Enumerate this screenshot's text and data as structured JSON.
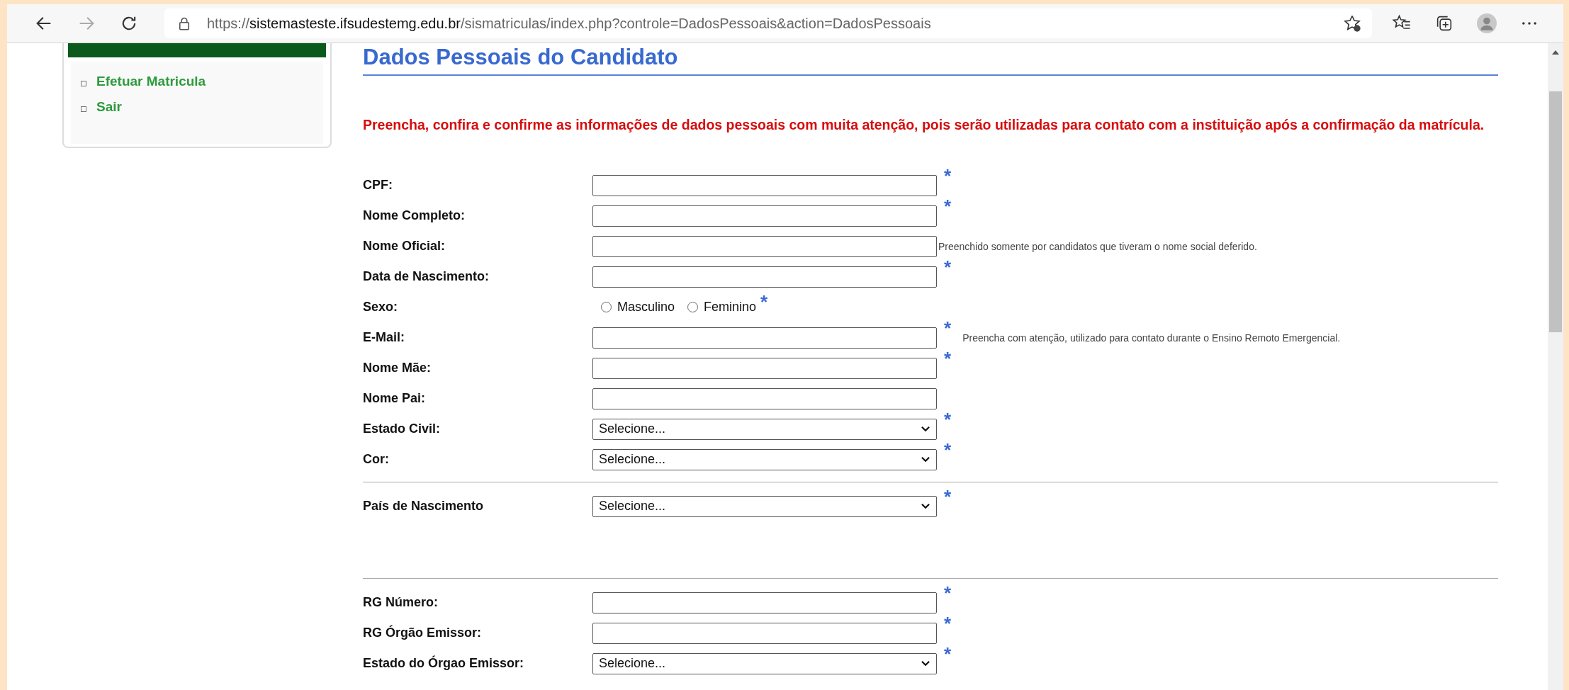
{
  "browser": {
    "url": {
      "scheme": "https://",
      "host": "sistemasteste.ifsudestemg.edu.br",
      "path": "/sismatriculas/index.php?controle=DadosPessoais&action=DadosPessoais"
    }
  },
  "sidebar": {
    "items": [
      {
        "label": "Efetuar Matricula"
      },
      {
        "label": "Sair"
      }
    ]
  },
  "page": {
    "title": "Dados Pessoais do Candidato",
    "notice": "Preencha, confira e confirme as informações de dados pessoais com muita atenção, pois serão utilizadas para contato com a instituição após a confirmação da matrícula."
  },
  "sections": [
    {
      "rows": [
        {
          "kind": "text",
          "label": "CPF:",
          "mark": "*"
        },
        {
          "kind": "text",
          "label": "Nome Completo:",
          "mark": "*"
        },
        {
          "kind": "text",
          "label": "Nome Oficial:",
          "hint": "Preenchido somente por candidatos que tiveram o nome social deferido."
        },
        {
          "kind": "text",
          "label": "Data de Nascimento:",
          "mark": "*"
        },
        {
          "kind": "radio",
          "label": "Sexo:",
          "mark": "*",
          "options": [
            {
              "label": "Masculino",
              "selected": false
            },
            {
              "label": "Feminino",
              "selected": false
            }
          ]
        },
        {
          "kind": "text",
          "label": "E-Mail:",
          "mark": "*",
          "hint": "Preencha com atenção, utilizado para contato durante o Ensino Remoto Emergencial."
        },
        {
          "kind": "text",
          "label": "Nome Mãe:",
          "mark": "*"
        },
        {
          "kind": "text",
          "label": "Nome Pai:"
        },
        {
          "kind": "select",
          "label": "Estado Civil:",
          "value": "Selecione...",
          "mark": "*"
        },
        {
          "kind": "select",
          "label": "Cor:",
          "value": "Selecione...",
          "mark": "*"
        }
      ]
    },
    {
      "rows": [
        {
          "kind": "select",
          "label": "País de Nascimento",
          "value": "Selecione...",
          "mark": "*"
        }
      ]
    },
    {
      "rows": [
        {
          "kind": "text",
          "label": "RG Número:",
          "mark": "*"
        },
        {
          "kind": "text",
          "label": "RG Órgão Emissor:",
          "mark": "*"
        },
        {
          "kind": "select",
          "label": "Estado do Órgao Emissor:",
          "value": "Selecione...",
          "mark": "*"
        }
      ]
    }
  ]
}
